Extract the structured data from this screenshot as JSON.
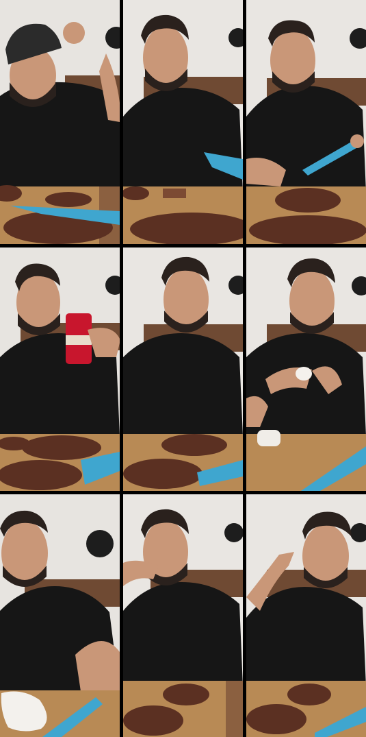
{
  "frames": [
    {
      "id": "frame-1",
      "gesture": "adjusting-cap",
      "props": [
        "steak",
        "knife",
        "cutting-board"
      ]
    },
    {
      "id": "frame-2",
      "gesture": "talking",
      "props": [
        "steak-slice",
        "knife",
        "cutting-board"
      ]
    },
    {
      "id": "frame-3",
      "gesture": "cutting",
      "props": [
        "steak",
        "knife",
        "cutting-board"
      ]
    },
    {
      "id": "frame-4",
      "gesture": "holding-can",
      "props": [
        "red-can",
        "steak",
        "knife",
        "cutting-board"
      ]
    },
    {
      "id": "frame-5",
      "gesture": "talking",
      "props": [
        "steak",
        "knife",
        "cutting-board"
      ]
    },
    {
      "id": "frame-6",
      "gesture": "holding-tissue",
      "props": [
        "salt-shaker",
        "knife",
        "cutting-board"
      ]
    },
    {
      "id": "frame-7",
      "gesture": "selfie-reach",
      "props": [
        "tissue",
        "knife",
        "cutting-board"
      ]
    },
    {
      "id": "frame-8",
      "gesture": "eating",
      "props": [
        "steak",
        "cutting-board"
      ]
    },
    {
      "id": "frame-9",
      "gesture": "scratching-ear",
      "props": [
        "steak",
        "knife",
        "cutting-board"
      ]
    }
  ],
  "colors": {
    "wall": "#e9e6e2",
    "cabinet": "#6f4a33",
    "shirt": "#161616",
    "skin": "#c99778",
    "hair": "#2a211d",
    "board": "#b88a55",
    "steak": "#5b3022",
    "knife": "#3fa6cf",
    "can": "#c8162d",
    "divider": "#000000"
  },
  "icons": [
    "speaker-icon"
  ]
}
